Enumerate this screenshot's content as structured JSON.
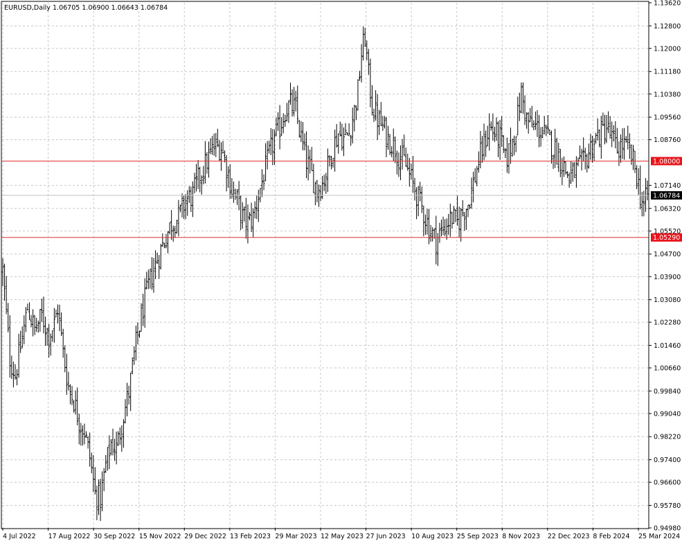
{
  "header": {
    "symbol": "EURUSD,Daily",
    "ohlc": "1.06705 1.06900 1.06643 1.06784"
  },
  "colors": {
    "background": "#ffffff",
    "bars": "#000000",
    "grid": "#c8c8c8",
    "level_line": "#e03030",
    "level_tag_bg": "#e8141b",
    "price_tag_bg": "#000000",
    "current_line": "#c0c0c0"
  },
  "chart_data": {
    "type": "ohlc-bar",
    "ylim": [
      0.9498,
      1.1362
    ],
    "grid": true,
    "y_ticks": [
      "1.13620",
      "1.12800",
      "1.12000",
      "1.11180",
      "1.10380",
      "1.09560",
      "1.08760",
      "1.07140",
      "1.06320",
      "1.05520",
      "1.04700",
      "1.03900",
      "1.03080",
      "1.02280",
      "1.01460",
      "1.00660",
      "0.99840",
      "0.99040",
      "0.98220",
      "0.97400",
      "0.96600",
      "0.95780",
      "0.94980"
    ],
    "x_ticks": [
      "4 Jul 2022",
      "17 Aug 2022",
      "30 Sep 2022",
      "15 Nov 2022",
      "29 Dec 2022",
      "13 Feb 2023",
      "29 Mar 2023",
      "12 May 2023",
      "27 Jun 2023",
      "10 Aug 2023",
      "25 Sep 2023",
      "8 Nov 2023",
      "22 Dec 2023",
      "8 Feb 2024",
      "25 Mar 2024"
    ],
    "levels": [
      {
        "value": 1.08,
        "label": "1.08000"
      },
      {
        "value": 1.0529,
        "label": "1.05290"
      }
    ],
    "current": {
      "value": 1.06784,
      "label": "1.06784"
    },
    "close_path": [
      [
        0,
        1.041
      ],
      [
        4,
        1.01
      ],
      [
        7,
        1.004
      ],
      [
        10,
        1.014
      ],
      [
        14,
        1.028
      ],
      [
        18,
        1.02
      ],
      [
        22,
        1.025
      ],
      [
        26,
        1.018
      ],
      [
        29,
        1.022
      ],
      [
        31,
        1.028
      ],
      [
        34,
        1.012
      ],
      [
        37,
        1.0
      ],
      [
        40,
        0.995
      ],
      [
        43,
        0.988
      ],
      [
        46,
        0.984
      ],
      [
        49,
        0.975
      ],
      [
        52,
        0.962
      ],
      [
        55,
        0.96
      ],
      [
        58,
        0.972
      ],
      [
        61,
        0.98
      ],
      [
        64,
        0.978
      ],
      [
        68,
        0.99
      ],
      [
        71,
        0.998
      ],
      [
        75,
        1.015
      ],
      [
        79,
        1.028
      ],
      [
        83,
        1.038
      ],
      [
        87,
        1.045
      ],
      [
        91,
        1.052
      ],
      [
        95,
        1.058
      ],
      [
        99,
        1.06
      ],
      [
        103,
        1.066
      ],
      [
        107,
        1.068
      ],
      [
        111,
        1.075
      ],
      [
        115,
        1.08
      ],
      [
        119,
        1.085
      ],
      [
        123,
        1.085
      ],
      [
        126,
        1.078
      ],
      [
        129,
        1.07
      ],
      [
        132,
        1.066
      ],
      [
        135,
        1.06
      ],
      [
        138,
        1.058
      ],
      [
        141,
        1.06
      ],
      [
        144,
        1.068
      ],
      [
        147,
        1.075
      ],
      [
        150,
        1.082
      ],
      [
        153,
        1.088
      ],
      [
        156,
        1.092
      ],
      [
        159,
        1.098
      ],
      [
        162,
        1.1
      ],
      [
        165,
        1.098
      ],
      [
        168,
        1.088
      ],
      [
        171,
        1.08
      ],
      [
        174,
        1.075
      ],
      [
        177,
        1.07
      ],
      [
        180,
        1.072
      ],
      [
        183,
        1.078
      ],
      [
        186,
        1.085
      ],
      [
        189,
        1.09
      ],
      [
        192,
        1.088
      ],
      [
        195,
        1.09
      ],
      [
        198,
        1.098
      ],
      [
        200,
        1.105
      ],
      [
        202,
        1.118
      ],
      [
        204,
        1.124
      ],
      [
        206,
        1.11
      ],
      [
        208,
        1.1
      ],
      [
        211,
        1.095
      ],
      [
        214,
        1.092
      ],
      [
        217,
        1.088
      ],
      [
        220,
        1.086
      ],
      [
        223,
        1.082
      ],
      [
        226,
        1.08
      ],
      [
        229,
        1.075
      ],
      [
        232,
        1.07
      ],
      [
        235,
        1.065
      ],
      [
        238,
        1.06
      ],
      [
        241,
        1.055
      ],
      [
        244,
        1.052
      ],
      [
        247,
        1.055
      ],
      [
        250,
        1.058
      ],
      [
        253,
        1.06
      ],
      [
        256,
        1.058
      ],
      [
        259,
        1.062
      ],
      [
        262,
        1.065
      ],
      [
        265,
        1.072
      ],
      [
        268,
        1.08
      ],
      [
        271,
        1.086
      ],
      [
        274,
        1.092
      ],
      [
        277,
        1.09
      ],
      [
        280,
        1.088
      ],
      [
        283,
        1.08
      ],
      [
        286,
        1.085
      ],
      [
        289,
        1.092
      ],
      [
        292,
        1.104
      ],
      [
        295,
        1.095
      ],
      [
        298,
        1.092
      ],
      [
        301,
        1.092
      ],
      [
        304,
        1.09
      ],
      [
        307,
        1.088
      ],
      [
        310,
        1.085
      ],
      [
        313,
        1.082
      ],
      [
        316,
        1.078
      ],
      [
        319,
        1.074
      ],
      [
        322,
        1.076
      ],
      [
        325,
        1.078
      ],
      [
        328,
        1.08
      ],
      [
        331,
        1.085
      ],
      [
        334,
        1.088
      ],
      [
        337,
        1.09
      ],
      [
        340,
        1.092
      ],
      [
        343,
        1.088
      ],
      [
        346,
        1.084
      ],
      [
        349,
        1.086
      ],
      [
        352,
        1.084
      ],
      [
        355,
        1.08
      ],
      [
        357,
        1.075
      ],
      [
        359,
        1.068
      ],
      [
        361,
        1.064
      ],
      [
        362,
        1.066
      ],
      [
        363,
        1.068
      ]
    ],
    "bar_count": 364
  }
}
